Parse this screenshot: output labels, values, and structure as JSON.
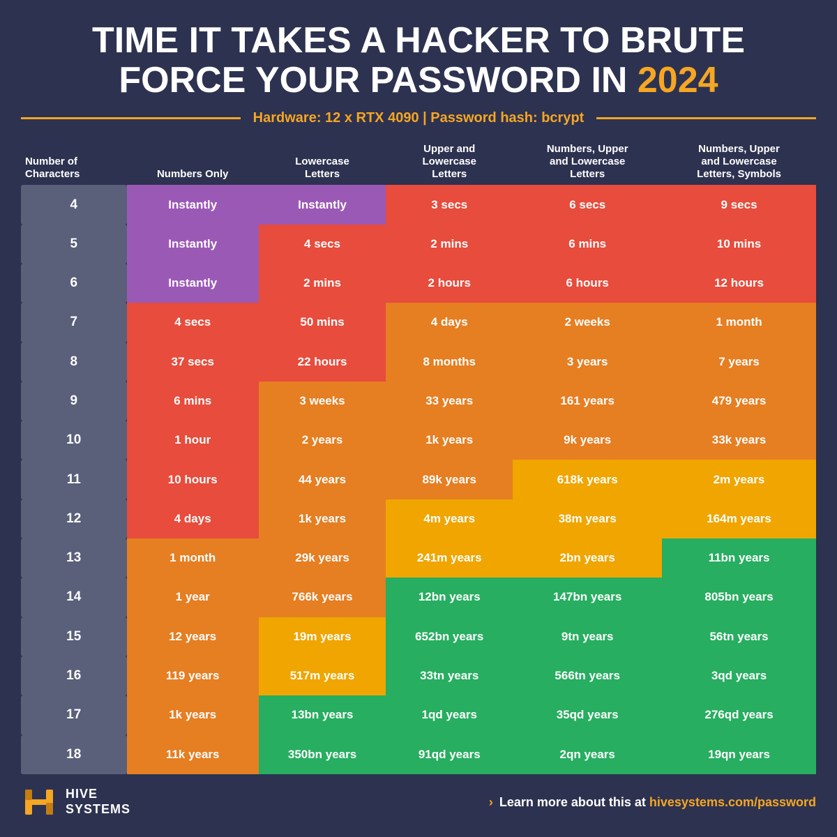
{
  "title": {
    "line1": "TIME IT TAKES A HACKER TO BRUTE",
    "line2_prefix": "FORCE YOUR PASSWORD IN ",
    "year": "2024"
  },
  "hardware": {
    "text": "Hardware: 12 x RTX 4090  |  Password hash: bcrypt"
  },
  "table": {
    "headers": [
      "Number of Characters",
      "Numbers Only",
      "Lowercase Letters",
      "Upper and Lowercase Letters",
      "Numbers, Upper and Lowercase Letters",
      "Numbers, Upper and Lowercase Letters, Symbols"
    ],
    "rows": [
      {
        "chars": "4",
        "cols": [
          "Instantly",
          "Instantly",
          "3 secs",
          "6 secs",
          "9 secs"
        ],
        "colors": [
          "purple",
          "purple",
          "red",
          "red",
          "red"
        ]
      },
      {
        "chars": "5",
        "cols": [
          "Instantly",
          "4 secs",
          "2 mins",
          "6 mins",
          "10 mins"
        ],
        "colors": [
          "purple",
          "red",
          "red",
          "red",
          "red"
        ]
      },
      {
        "chars": "6",
        "cols": [
          "Instantly",
          "2 mins",
          "2 hours",
          "6 hours",
          "12 hours"
        ],
        "colors": [
          "purple",
          "red",
          "red",
          "red",
          "red"
        ]
      },
      {
        "chars": "7",
        "cols": [
          "4 secs",
          "50 mins",
          "4 days",
          "2 weeks",
          "1 month"
        ],
        "colors": [
          "red",
          "red",
          "orange",
          "orange",
          "orange"
        ]
      },
      {
        "chars": "8",
        "cols": [
          "37 secs",
          "22 hours",
          "8 months",
          "3 years",
          "7 years"
        ],
        "colors": [
          "red",
          "red",
          "orange",
          "orange",
          "orange"
        ]
      },
      {
        "chars": "9",
        "cols": [
          "6 mins",
          "3 weeks",
          "33 years",
          "161 years",
          "479 years"
        ],
        "colors": [
          "red",
          "orange",
          "orange",
          "orange",
          "orange"
        ]
      },
      {
        "chars": "10",
        "cols": [
          "1 hour",
          "2 years",
          "1k years",
          "9k years",
          "33k years"
        ],
        "colors": [
          "red",
          "orange",
          "orange",
          "orange",
          "orange"
        ]
      },
      {
        "chars": "11",
        "cols": [
          "10 hours",
          "44 years",
          "89k years",
          "618k years",
          "2m years"
        ],
        "colors": [
          "red",
          "orange",
          "orange",
          "yellow",
          "yellow"
        ]
      },
      {
        "chars": "12",
        "cols": [
          "4 days",
          "1k years",
          "4m years",
          "38m years",
          "164m years"
        ],
        "colors": [
          "red",
          "orange",
          "yellow",
          "yellow",
          "yellow"
        ]
      },
      {
        "chars": "13",
        "cols": [
          "1 month",
          "29k years",
          "241m years",
          "2bn years",
          "11bn years"
        ],
        "colors": [
          "orange",
          "orange",
          "yellow",
          "yellow",
          "green"
        ]
      },
      {
        "chars": "14",
        "cols": [
          "1 year",
          "766k years",
          "12bn years",
          "147bn years",
          "805bn years"
        ],
        "colors": [
          "orange",
          "orange",
          "green",
          "green",
          "green"
        ]
      },
      {
        "chars": "15",
        "cols": [
          "12 years",
          "19m years",
          "652bn years",
          "9tn years",
          "56tn years"
        ],
        "colors": [
          "orange",
          "yellow",
          "green",
          "green",
          "green"
        ]
      },
      {
        "chars": "16",
        "cols": [
          "119 years",
          "517m years",
          "33tn years",
          "566tn years",
          "3qd years"
        ],
        "colors": [
          "orange",
          "yellow",
          "green",
          "green",
          "green"
        ]
      },
      {
        "chars": "17",
        "cols": [
          "1k years",
          "13bn years",
          "1qd years",
          "35qd years",
          "276qd years"
        ],
        "colors": [
          "orange",
          "green",
          "green",
          "green",
          "green"
        ]
      },
      {
        "chars": "18",
        "cols": [
          "11k years",
          "350bn years",
          "91qd years",
          "2qn years",
          "19qn years"
        ],
        "colors": [
          "orange",
          "green",
          "green",
          "green",
          "green"
        ]
      }
    ]
  },
  "footer": {
    "logo_line1": "HIVE",
    "logo_line2": "SYSTEMS",
    "link_prefix": "› Learn more about this at ",
    "link_url": "hivesystems.com/password"
  }
}
